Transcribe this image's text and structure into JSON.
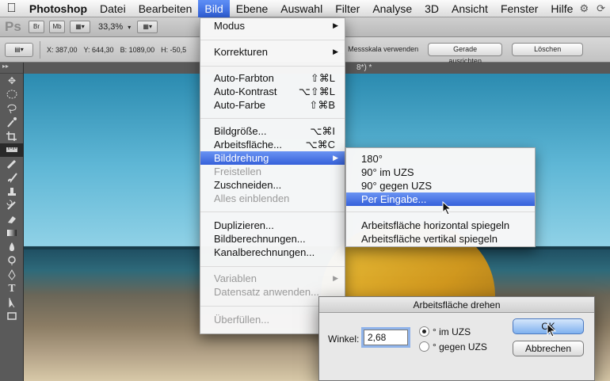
{
  "menubar": {
    "app_name": "Photoshop",
    "items": [
      "Datei",
      "Bearbeiten",
      "Bild",
      "Ebene",
      "Auswahl",
      "Filter",
      "Analyse",
      "3D",
      "Ansicht",
      "Fenster",
      "Hilfe"
    ],
    "active_item": "Bild"
  },
  "appbar": {
    "logo": "Ps",
    "br": "Br",
    "mb": "Mb",
    "zoom": "33,3%"
  },
  "options": {
    "x": "X: 387,00",
    "y": "Y: 644,30",
    "b": "B: 1089,00",
    "h": "H: -50,5",
    "measure_scale": "Messskala verwenden",
    "straighten": "Gerade ausrichten",
    "clear": "Löschen"
  },
  "document": {
    "tab_suffix": "8*) *"
  },
  "bild_menu": {
    "modus": "Modus",
    "korrekturen": "Korrekturen",
    "auto_farbton": "Auto-Farbton",
    "auto_farbton_sc": "⇧⌘L",
    "auto_kontrast": "Auto-Kontrast",
    "auto_kontrast_sc": "⌥⇧⌘L",
    "auto_farbe": "Auto-Farbe",
    "auto_farbe_sc": "⇧⌘B",
    "bildgroesse": "Bildgröße...",
    "bildgroesse_sc": "⌥⌘I",
    "arbeitsflaeche": "Arbeitsfläche...",
    "arbeitsflaeche_sc": "⌥⌘C",
    "bilddrehung": "Bilddrehung",
    "freistellen": "Freistellen",
    "zuschneiden": "Zuschneiden...",
    "alles_einblenden": "Alles einblenden",
    "duplizieren": "Duplizieren...",
    "bildberechnungen": "Bildberechnungen...",
    "kanalberechnungen": "Kanalberechnungen...",
    "variablen": "Variablen",
    "datensatz": "Datensatz anwenden...",
    "ueberfuellen": "Überfüllen..."
  },
  "rotation_menu": {
    "r180": "180°",
    "r90cw": "90° im UZS",
    "r90ccw": "90° gegen UZS",
    "per_eingabe": "Per Eingabe...",
    "flip_h": "Arbeitsfläche horizontal spiegeln",
    "flip_v": "Arbeitsfläche vertikal spiegeln"
  },
  "dialog": {
    "title": "Arbeitsfläche drehen",
    "winkel_label": "Winkel:",
    "winkel_value": "2,68",
    "radio_cw": "° im UZS",
    "radio_ccw": "° gegen UZS",
    "selected_direction": "cw",
    "ok": "OK",
    "cancel": "Abbrechen"
  },
  "colors": {
    "menu_highlight": "#3560da",
    "default_button": "#7fb1ef"
  }
}
